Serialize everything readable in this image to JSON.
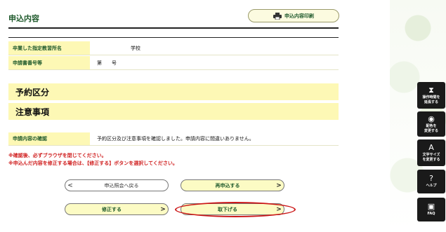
{
  "header": {
    "title": "申込内容",
    "print_label": "申込内容印刷"
  },
  "details": [
    {
      "label": "卒業した指定教習所名",
      "value": "学校"
    },
    {
      "label": "申請書番号等",
      "value": "第　　号"
    }
  ],
  "sections": {
    "reservation": "予約区分",
    "notice": "注意事項"
  },
  "confirm": {
    "label": "申請内容の確認",
    "value": "予約区分及び注意事項を確認しました。申請内容に間違いありません。"
  },
  "notes": [
    "※確認後、必ずブラウザを閉じてください。",
    "※申込んだ内容を修正する場合は、【修正する】ボタンを選択してください。"
  ],
  "buttons": {
    "back": "申込照会へ戻る",
    "reapply": "再申込する",
    "edit": "修正する",
    "withdraw": "取下げる"
  },
  "side": [
    {
      "icon": "hourglass-icon",
      "label": "操作時間を\n延長する"
    },
    {
      "icon": "palette-icon",
      "label": "配色を\n変更する"
    },
    {
      "icon": "font-size-icon",
      "label": "文字サイズ\nを変更する"
    },
    {
      "icon": "help-icon",
      "label": "ヘルプ"
    },
    {
      "icon": "faq-icon",
      "label": "FAQ"
    }
  ],
  "colors": {
    "label_bg": "#fdf8b5",
    "accent_text": "#1f5a2c",
    "warning": "#d02020",
    "highlight_ring": "#cc1818"
  }
}
